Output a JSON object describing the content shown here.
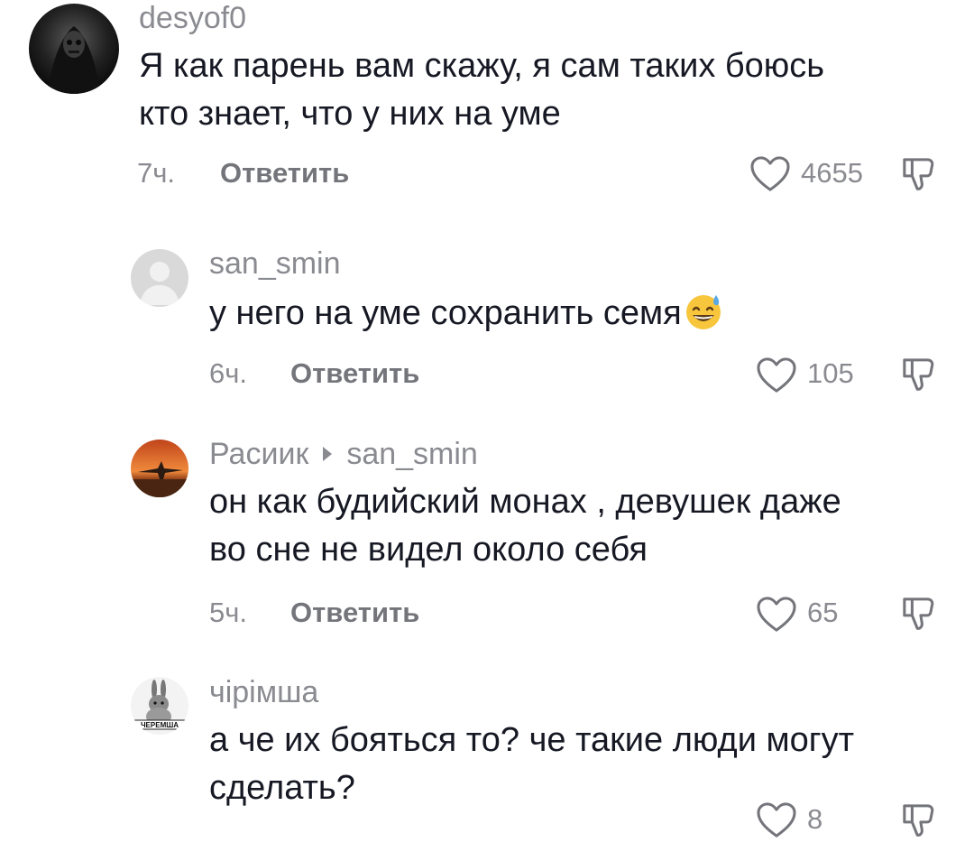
{
  "comments": [
    {
      "username": "desyof0",
      "text_lines": [
        "Я как парень вам скажу, я сам таких боюсь",
        "кто знает, что у них на уме"
      ],
      "time": "7ч.",
      "reply_label": "Ответить",
      "likes": "4655"
    },
    {
      "username": "san_smin",
      "text_lines": [
        "у него на уме сохранить семя"
      ],
      "emoji": "grinning-face-with-sweat-emoji",
      "time": "6ч.",
      "reply_label": "Ответить",
      "likes": "105"
    },
    {
      "username": "Расиик",
      "reply_to": "san_smin",
      "text_lines": [
        "он как будийский монах , девушек даже",
        "во сне не видел около себя"
      ],
      "time": "5ч.",
      "reply_label": "Ответить",
      "likes": "65"
    },
    {
      "username": "чірімша",
      "text_lines": [
        "а че их бояться то? че такие люди могут",
        "сделать?"
      ],
      "likes": "8",
      "avatar_text": "ЧЕРЕМША"
    }
  ],
  "icons": {
    "like": "heart-outline-icon",
    "dislike": "thumbs-down-icon"
  },
  "colors": {
    "text": "#161823",
    "secondary": "#8a8b91",
    "reply": "#74757b"
  }
}
